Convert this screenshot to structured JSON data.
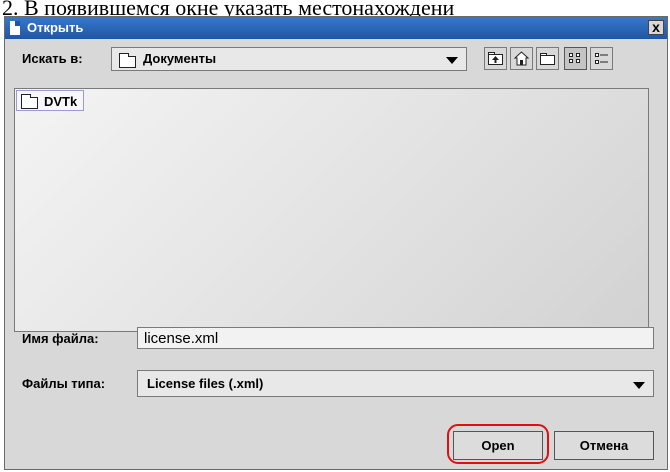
{
  "document": {
    "line": "2.  В появившемся окне указать местонахождени"
  },
  "dialog": {
    "title": "Открыть",
    "close_glyph": "x",
    "look_in": {
      "label": "Искать в:",
      "value": "Документы"
    },
    "toolbar": [
      "up-folder-icon",
      "home-icon",
      "new-folder-icon",
      "list-view-icon",
      "details-view-icon"
    ],
    "file_list": {
      "items": [
        {
          "name": "DVTk",
          "type": "folder"
        }
      ]
    },
    "file_name": {
      "label": "Имя файла:",
      "value": "license.xml"
    },
    "file_type": {
      "label": "Файлы типа:",
      "value": "License files (.xml)"
    },
    "buttons": {
      "open": "Open",
      "cancel": "Отмена"
    },
    "highlight_color": "#e01010",
    "title_color": "#1e56a6"
  }
}
